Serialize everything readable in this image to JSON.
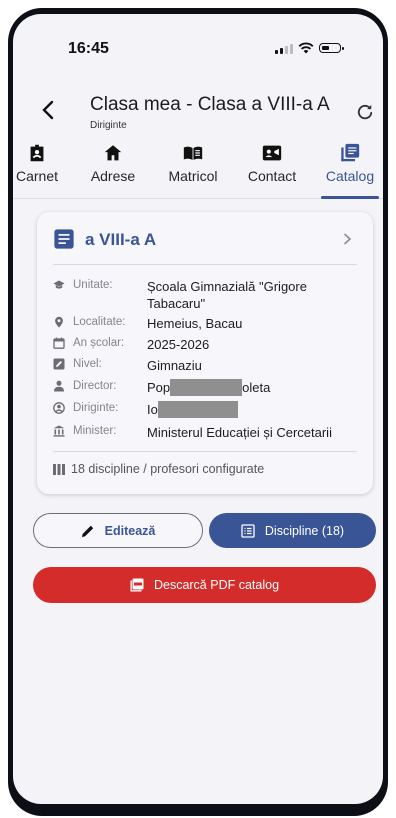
{
  "status_bar": {
    "time": "16:45"
  },
  "appbar": {
    "title": "Clasa mea - Clasa a VIII-a A",
    "subtitle": "Diriginte"
  },
  "tabs": [
    {
      "label": "Carnet",
      "icon": "badge-icon"
    },
    {
      "label": "Adrese",
      "icon": "home-icon"
    },
    {
      "label": "Matricol",
      "icon": "book-icon"
    },
    {
      "label": "Contact",
      "icon": "contact-card-icon"
    },
    {
      "label": "Catalog",
      "icon": "catalog-icon",
      "active": true
    }
  ],
  "card": {
    "title": "a VIII-a A",
    "rows": [
      {
        "label": "Unitate:",
        "value": "Școala Gimnazială \"Grigore Tabacaru\"",
        "icon": "graduation-cap-icon"
      },
      {
        "label": "Localitate:",
        "value": "Hemeius, Bacau",
        "icon": "location-pin-icon"
      },
      {
        "label": "An școlar:",
        "value": "2025-2026",
        "icon": "calendar-icon"
      },
      {
        "label": "Nivel:",
        "value": "Gimnaziu",
        "icon": "edit-square-icon"
      },
      {
        "label": "Director:",
        "value_prefix": "Pop",
        "value_suffix": "oleta",
        "icon": "person-icon"
      },
      {
        "label": "Diriginte:",
        "value_prefix": "Io",
        "value_suffix": "",
        "icon": "account-circle-icon"
      },
      {
        "label": "Minister:",
        "value": "Ministerul Educației și Cercetarii",
        "icon": "bank-icon"
      }
    ],
    "footer": "18 discipline / profesori configurate"
  },
  "buttons": {
    "edit": "Editează",
    "disciplines": "Discipline (18)",
    "pdf": "Descarcă PDF catalog"
  },
  "colors": {
    "accent": "#3a5595",
    "danger": "#d42b2b",
    "background": "#f4f3f8"
  }
}
